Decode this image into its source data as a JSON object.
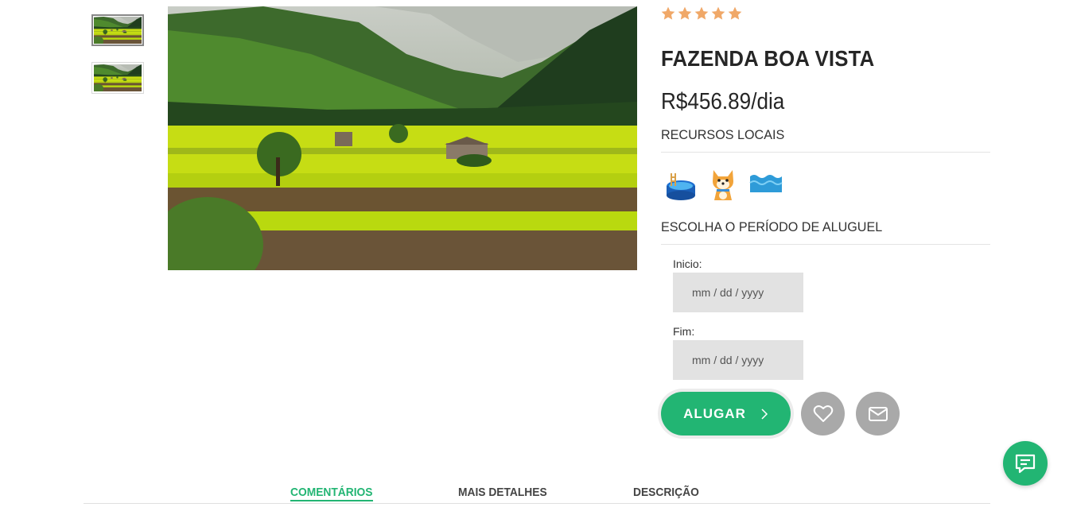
{
  "product": {
    "title": "FAZENDA BOA VISTA",
    "price": "R$456.89/dia",
    "rating_stars": 5,
    "star_color": "#f0a868"
  },
  "gallery": {
    "thumbnails": [
      {
        "icon": "landscape-thumbnail",
        "active": true
      },
      {
        "icon": "landscape-thumbnail",
        "active": false
      }
    ],
    "main_image": "valley-landscape-photo"
  },
  "features": {
    "label": "RECURSOS LOCAIS",
    "icons": [
      "pool-icon",
      "dog-icon",
      "water-icon"
    ]
  },
  "rental": {
    "label": "ESCOLHA O PERÍODO DE ALUGUEL",
    "start_label": "Inicio:",
    "end_label": "Fim:",
    "date_placeholder": "mm / dd / yyyy",
    "rent_button": "ALUGAR"
  },
  "tabs": [
    {
      "label": "COMENTÁRIOS",
      "active": true
    },
    {
      "label": "MAIS DETALHES",
      "active": false
    },
    {
      "label": "DESCRIÇÃO",
      "active": false
    }
  ],
  "colors": {
    "accent": "#22b573",
    "secondary_button": "#a9a9a9",
    "input_bg": "#e2e2e2"
  }
}
